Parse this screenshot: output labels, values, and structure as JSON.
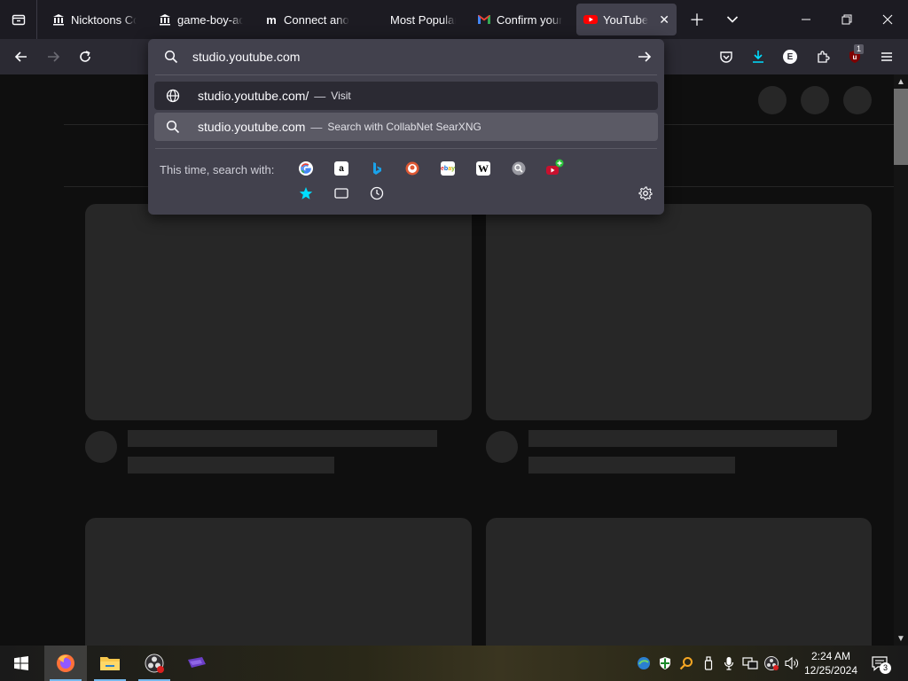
{
  "tabs": [
    {
      "title": "Nicktoons Co",
      "favicon": "bank-icon",
      "active": false
    },
    {
      "title": "game-boy-ad",
      "favicon": "bank-icon",
      "active": false
    },
    {
      "title": "Connect anot",
      "favicon": "m-logo-icon",
      "active": false
    },
    {
      "title": "Most Popular",
      "favicon": "none",
      "active": false
    },
    {
      "title": "Confirm your",
      "favicon": "gmail-icon",
      "active": false
    },
    {
      "title": "YouTube",
      "favicon": "youtube-icon",
      "active": true
    }
  ],
  "urlbar": {
    "value": "studio.youtube.com",
    "suggestions": [
      {
        "text": "studio.youtube.com/",
        "action": "Visit",
        "icon": "globe-icon"
      },
      {
        "text": "studio.youtube.com",
        "action": "Search with CollabNet SearXNG",
        "icon": "search-icon"
      }
    ],
    "engines_label": "This time, search with:",
    "engines": [
      "Google",
      "Amazon",
      "Bing",
      "DuckDuckGo",
      "eBay",
      "Wikipedia",
      "SearXNG",
      "YouTube (add)"
    ],
    "modes": [
      "Bookmarks",
      "Tabs",
      "History"
    ]
  },
  "toolbar": {
    "extension_badge": "1"
  },
  "taskbar": {
    "time": "2:24 AM",
    "date": "12/25/2024",
    "notification_count": "3",
    "apps": [
      "Firefox",
      "File Explorer",
      "OBS Studio",
      "App"
    ]
  },
  "colors": {
    "accent": "#00ddff",
    "youtube_red": "#ff0000",
    "skeleton": "#272727"
  }
}
